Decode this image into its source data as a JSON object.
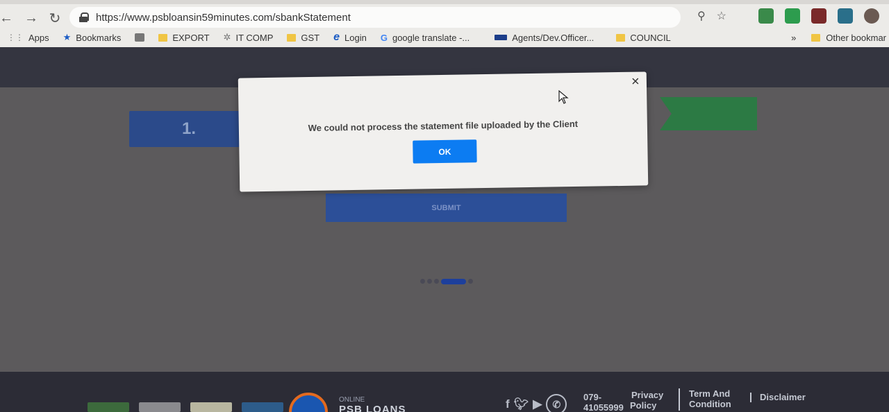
{
  "browser": {
    "url": "https://www.psbloansin59minutes.com/sbankStatement",
    "bookmarks": [
      {
        "label": "Apps",
        "icon": "apps-grid-icon"
      },
      {
        "label": "Bookmarks",
        "icon": "star-icon"
      },
      {
        "label": "",
        "icon": "emblem-icon"
      },
      {
        "label": "EXPORT",
        "icon": "folder-icon"
      },
      {
        "label": "IT COMP",
        "icon": "gear-icon"
      },
      {
        "label": "GST",
        "icon": "folder-icon"
      },
      {
        "label": "Login",
        "icon": "ie-icon"
      },
      {
        "label": "google translate -...",
        "icon": "google-icon"
      },
      {
        "label": "Agents/Dev.Officer...",
        "icon": "lic-icon"
      },
      {
        "label": "COUNCIL",
        "icon": "folder-icon"
      }
    ],
    "overflow": "»",
    "other_bookmarks": "Other bookmar"
  },
  "page": {
    "step_number": "1.",
    "submit_label": "SUBMIT"
  },
  "modal": {
    "message": "We could not process the statement file uploaded by the Client",
    "ok_label": "OK",
    "close_symbol": "×"
  },
  "footer": {
    "brand_small": "ONLINE",
    "brand_big": "PSB LOANS",
    "phone_line1": "079-",
    "phone_line2": "41055999",
    "privacy_line1": "Privacy",
    "privacy_line2": "Policy",
    "term_line1": "Term And",
    "term_line2": "Condition",
    "disclaimer": "Disclaimer"
  },
  "colors": {
    "ok_button": "#0c7cf2",
    "submit_button": "#2c4f98",
    "step_box": "#2b4a8a",
    "green_step": "#2c7a44",
    "footer_bg": "#2c2c36"
  }
}
